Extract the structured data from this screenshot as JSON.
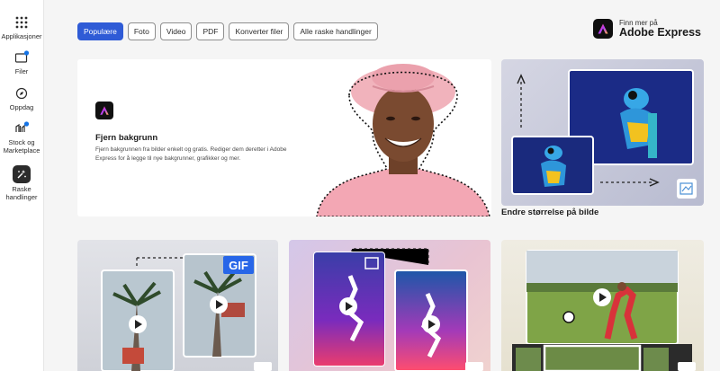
{
  "sidebar": {
    "items": [
      {
        "label": "Applikasjoner",
        "icon": "grid-icon"
      },
      {
        "label": "Filer",
        "icon": "folder-icon"
      },
      {
        "label": "Oppdag",
        "icon": "compass-icon"
      },
      {
        "label_line1": "Stock og",
        "label_line2": "Marketplace",
        "icon": "stock-icon"
      },
      {
        "label_line1": "Raske",
        "label_line2": "handlinger",
        "icon": "quick-actions-icon"
      }
    ]
  },
  "filters": [
    "Populære",
    "Foto",
    "Video",
    "PDF",
    "Konverter filer",
    "Alle raske handlinger"
  ],
  "brand": {
    "small": "Finn mer på",
    "big": "Adobe Express"
  },
  "hero": {
    "title": "Fjern bakgrunn",
    "description": "Fjern bakgrunnen fra bilder enkelt og gratis. Rediger dem deretter i Adobe Express for å legge til nye bakgrunner, grafikker og mer."
  },
  "resize_card": {
    "label": "Endre størrelse på bilde"
  },
  "cards": {
    "gif_badge": "GIF"
  },
  "colors": {
    "accent": "#2f5bd6",
    "sidebar_notification": "#1473e6"
  }
}
